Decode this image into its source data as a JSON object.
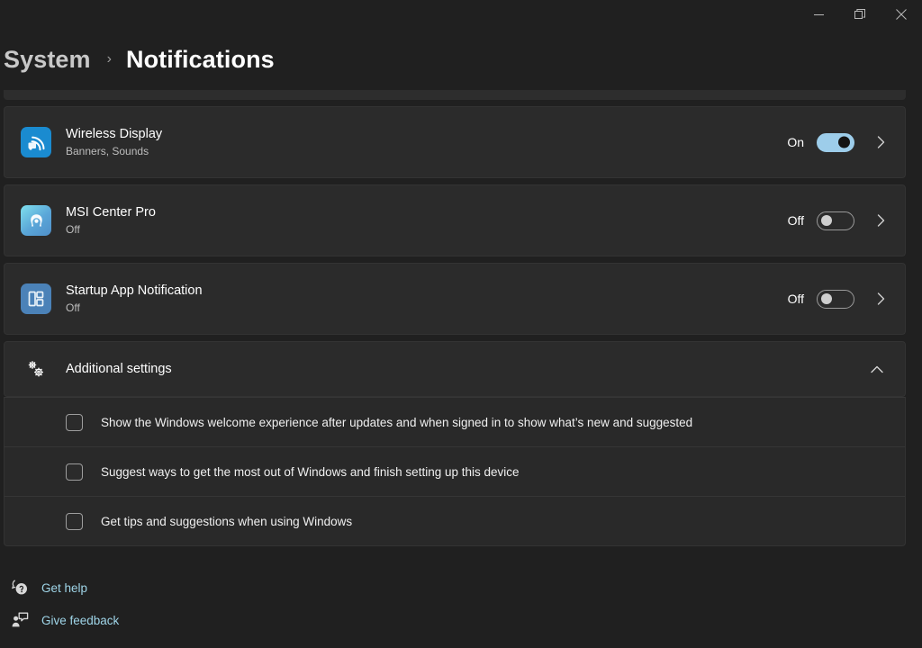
{
  "window": {
    "controls": [
      {
        "name": "minimize",
        "label": "Minimize"
      },
      {
        "name": "restore",
        "label": "Restore"
      },
      {
        "name": "close",
        "label": "Close"
      }
    ]
  },
  "header": {
    "parent": "System",
    "separator": "›",
    "current": "Notifications"
  },
  "app_list": [
    {
      "title": "Wireless Display",
      "subtitle": "Banners, Sounds",
      "toggle_state": "On",
      "toggle_on": true,
      "icon": "wireless-display-icon"
    },
    {
      "title": "MSI Center Pro",
      "subtitle": "Off",
      "toggle_state": "Off",
      "toggle_on": false,
      "icon": "msi-center-pro-icon"
    },
    {
      "title": "Startup App Notification",
      "subtitle": "Off",
      "toggle_state": "Off",
      "toggle_on": false,
      "icon": "startup-app-icon"
    }
  ],
  "additional_settings": {
    "label": "Additional settings",
    "expanded": true,
    "icon": "gears-icon",
    "chevron": "chevron-up-icon",
    "checkboxes": [
      {
        "label": "Show the Windows welcome experience after updates and when signed in to show what’s new and suggested",
        "checked": false
      },
      {
        "label": "Suggest ways to get the most out of Windows and finish setting up this device",
        "checked": false
      },
      {
        "label": "Get tips and suggestions when using Windows",
        "checked": false
      }
    ]
  },
  "footer": {
    "links": [
      {
        "label": "Get help",
        "icon": "help-icon"
      },
      {
        "label": "Give feedback",
        "icon": "feedback-icon"
      }
    ]
  },
  "colors": {
    "page_background": "#202020",
    "card_background": "#2b2b2b",
    "accent_toggle_on": "#9dcdea",
    "link": "#9fd5e8"
  }
}
